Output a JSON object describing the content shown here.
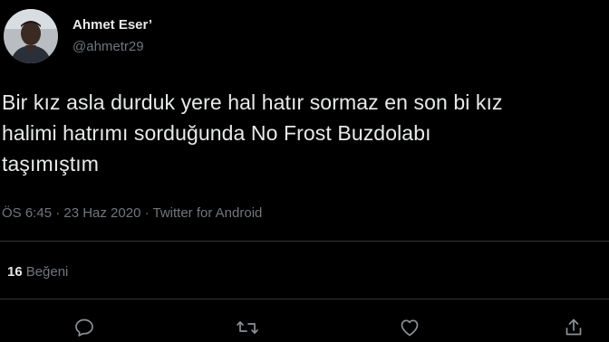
{
  "author": {
    "display_name": "Ahmet Eser’",
    "handle": "@ahmetr29"
  },
  "tweet": {
    "lines": [
      "Bir kız asla durduk yere hal hatır sormaz en son bi kız",
      "halimi hatrımı sorduğunda No Frost Buzdolabı",
      "taşımıştım"
    ],
    "meta": "ÖS 6:45 · 23 Haz 2020 · Twitter for Android"
  },
  "stats": {
    "likes_count": "16",
    "likes_label": "Beğeni"
  },
  "actions": [
    {
      "name": "reply-icon"
    },
    {
      "name": "retweet-icon"
    },
    {
      "name": "like-icon"
    },
    {
      "name": "share-icon"
    }
  ],
  "colors": {
    "background": "#000000",
    "text": "#e7e9ea",
    "secondary_text": "#71767b",
    "divider": "#2f3336"
  }
}
